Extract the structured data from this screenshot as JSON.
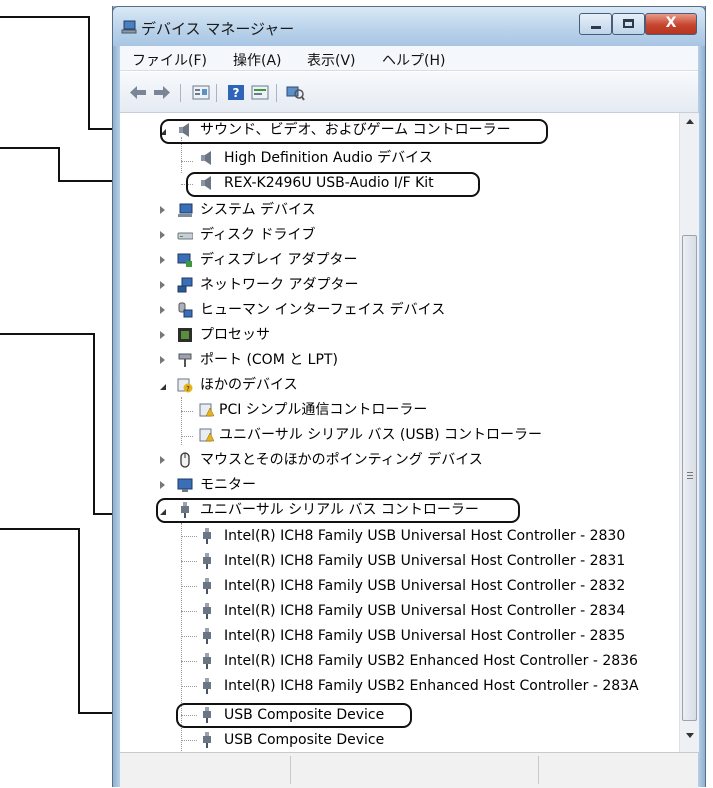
{
  "window": {
    "title": "デバイス マネージャー",
    "controls": {
      "minimize": "—",
      "maximize": "□",
      "close": "X"
    }
  },
  "menu": [
    "ファイル(F)",
    "操作(A)",
    "表示(V)",
    "ヘルプ(H)"
  ],
  "toolbar": [
    "back-arrow-icon",
    "forward-arrow-icon",
    "properties-icon",
    "help-icon",
    "update-driver-icon",
    "scan-hardware-icon"
  ],
  "tree": [
    {
      "label": "サウンド、ビデオ、およびゲーム コントローラー",
      "state": "expanded",
      "icon": "speaker-icon",
      "highlighted": true
    },
    {
      "label": "High Definition Audio デバイス",
      "icon": "speaker-icon"
    },
    {
      "label": "REX-K2496U USB-Audio I/F Kit",
      "icon": "speaker-icon",
      "highlighted": true
    },
    {
      "label": "システム デバイス",
      "state": "collapsed",
      "icon": "system-device-icon"
    },
    {
      "label": "ディスク ドライブ",
      "state": "collapsed",
      "icon": "disk-drive-icon"
    },
    {
      "label": "ディスプレイ アダプター",
      "state": "collapsed",
      "icon": "display-adapter-icon"
    },
    {
      "label": "ネットワーク アダプター",
      "state": "collapsed",
      "icon": "network-adapter-icon"
    },
    {
      "label": "ヒューマン インターフェイス デバイス",
      "state": "collapsed",
      "icon": "hid-icon"
    },
    {
      "label": "プロセッサ",
      "state": "collapsed",
      "icon": "processor-icon"
    },
    {
      "label": "ポート (COM と LPT)",
      "state": "collapsed",
      "icon": "port-icon"
    },
    {
      "label": "ほかのデバイス",
      "state": "expanded",
      "icon": "unknown-device-icon"
    },
    {
      "label": "PCI シンプル通信コントローラー",
      "icon": "warning-device-icon"
    },
    {
      "label": "ユニバーサル シリアル バス (USB) コントローラー",
      "icon": "warning-device-icon"
    },
    {
      "label": "マウスとそのほかのポインティング デバイス",
      "state": "collapsed",
      "icon": "mouse-icon"
    },
    {
      "label": "モニター",
      "state": "collapsed",
      "icon": "monitor-icon"
    },
    {
      "label": "ユニバーサル シリアル バス コントローラー",
      "state": "expanded",
      "icon": "usb-icon",
      "highlighted": true
    },
    {
      "label": "Intel(R) ICH8 Family USB Universal Host Controller - 2830",
      "icon": "usb-icon"
    },
    {
      "label": "Intel(R) ICH8 Family USB Universal Host Controller - 2831",
      "icon": "usb-icon"
    },
    {
      "label": "Intel(R) ICH8 Family USB Universal Host Controller - 2832",
      "icon": "usb-icon"
    },
    {
      "label": "Intel(R) ICH8 Family USB Universal Host Controller - 2834",
      "icon": "usb-icon"
    },
    {
      "label": "Intel(R) ICH8 Family USB Universal Host Controller - 2835",
      "icon": "usb-icon"
    },
    {
      "label": "Intel(R) ICH8 Family USB2 Enhanced Host Controller - 2836",
      "icon": "usb-icon"
    },
    {
      "label": "Intel(R) ICH8 Family USB2 Enhanced Host Controller - 283A",
      "icon": "usb-icon"
    },
    {
      "label": "USB Composite Device",
      "icon": "usb-icon",
      "highlighted": true
    },
    {
      "label": "USB Composite Device",
      "icon": "usb-icon"
    }
  ],
  "colors": {
    "titlebar": "#b9d2ea",
    "close_button": "#c5452e",
    "highlight_border": "#111111"
  }
}
